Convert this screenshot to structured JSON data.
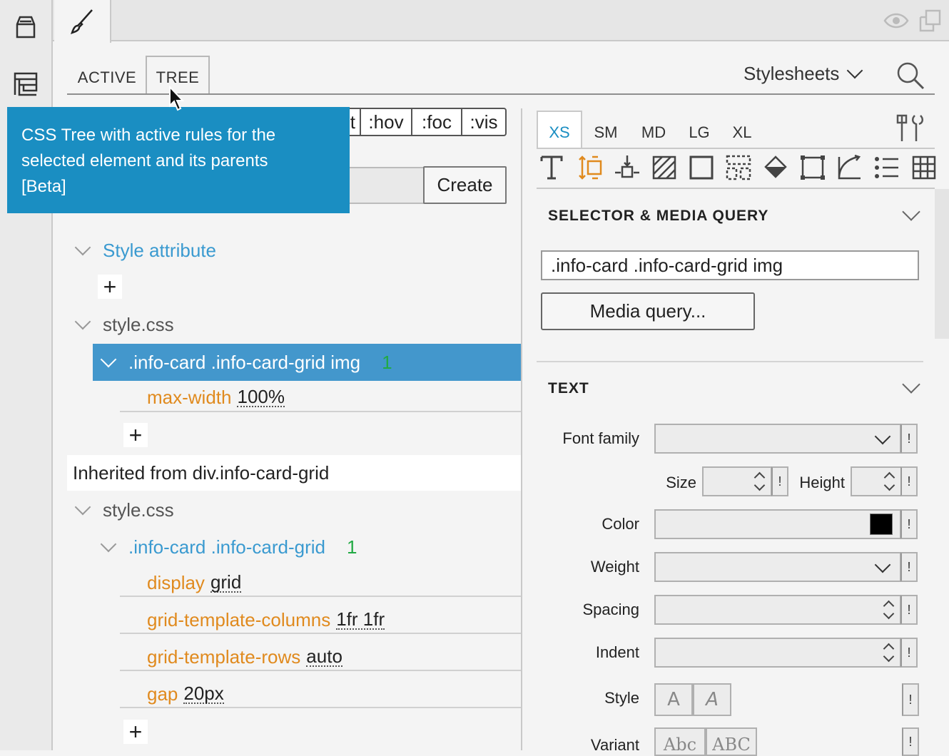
{
  "tabs": {
    "active": "ACTIVE",
    "tree": "TREE"
  },
  "stylesheets_label": "Stylesheets",
  "pseudo": [
    ":t",
    ":hov",
    ":foc",
    ":vis"
  ],
  "tooltip": {
    "line1": "CSS Tree with active rules for the",
    "line2": "selected element and its parents",
    "line3": "[Beta]"
  },
  "create_label": "Create",
  "tree": {
    "style_attribute": "Style attribute",
    "sheet1": "style.css",
    "rule1": {
      "selector": ".info-card .info-card-grid img",
      "count": "1",
      "props": [
        {
          "name": "max-width",
          "value": "100%"
        }
      ]
    },
    "inherited": "Inherited from div.info-card-grid",
    "sheet2": "style.css",
    "rule2": {
      "selector": ".info-card .info-card-grid",
      "count": "1",
      "props": [
        {
          "name": "display",
          "value": "grid"
        },
        {
          "name": "grid-template-columns",
          "value": "1fr 1fr"
        },
        {
          "name": "grid-template-rows",
          "value": "auto"
        },
        {
          "name": "gap",
          "value": "20px"
        }
      ]
    },
    "plus": "+"
  },
  "breakpoints": [
    "XS",
    "SM",
    "MD",
    "LG",
    "XL"
  ],
  "selector_section": {
    "title": "SELECTOR & MEDIA QUERY",
    "selector_value": ".info-card .info-card-grid img",
    "media_button": "Media query..."
  },
  "text_section": {
    "title": "TEXT",
    "labels": {
      "font_family": "Font family",
      "size": "Size",
      "height": "Height",
      "color": "Color",
      "weight": "Weight",
      "spacing": "Spacing",
      "indent": "Indent",
      "style": "Style",
      "variant": "Variant"
    },
    "important": "!",
    "color_swatch": "#000000",
    "style_buttons": [
      "A",
      "A"
    ],
    "variant_buttons": [
      "Abc",
      "ABC"
    ]
  },
  "colors": {
    "accent": "#1a8ec2",
    "selected_row": "#4397cc",
    "property": "#e08a1e",
    "count": "#22aa44"
  }
}
